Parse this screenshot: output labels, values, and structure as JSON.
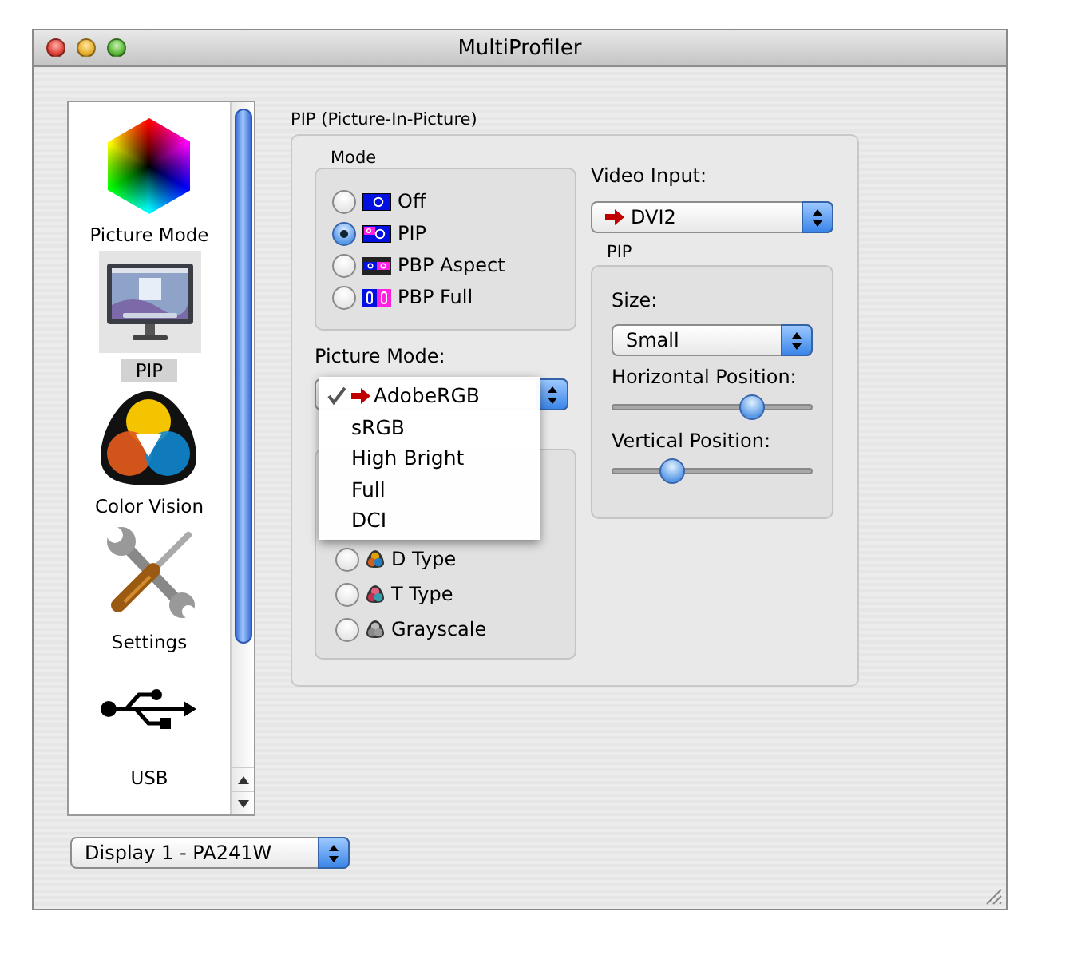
{
  "window": {
    "title": "MultiProfiler"
  },
  "sidebar": {
    "items": [
      {
        "label": "Picture Mode",
        "kind": "hexagon",
        "selected": false
      },
      {
        "label": "PIP",
        "kind": "monitor",
        "selected": true
      },
      {
        "label": "Color Vision",
        "kind": "colorvision",
        "selected": false
      },
      {
        "label": "Settings",
        "kind": "tools",
        "selected": false
      },
      {
        "label": "USB",
        "kind": "usb",
        "selected": false
      }
    ]
  },
  "pip_panel": {
    "title": "PIP (Picture-In-Picture)",
    "mode": {
      "title": "Mode",
      "options": [
        {
          "label": "Off",
          "kind": "off",
          "selected": false
        },
        {
          "label": "PIP",
          "kind": "pip",
          "selected": true
        },
        {
          "label": "PBP Aspect",
          "kind": "pbp-aspect",
          "selected": false
        },
        {
          "label": "PBP Full",
          "kind": "pbp-full",
          "selected": false
        }
      ]
    },
    "picture_mode": {
      "label": "Picture Mode:",
      "menu": [
        {
          "label": "AdobeRGB",
          "checked": true,
          "current": true
        },
        {
          "label": "sRGB",
          "checked": false,
          "current": false
        },
        {
          "label": "High Bright",
          "checked": false,
          "current": false
        },
        {
          "label": "Full",
          "checked": false,
          "current": false
        },
        {
          "label": "DCI",
          "checked": false,
          "current": false
        }
      ]
    },
    "color_vision": {
      "options": [
        {
          "label": "D Type",
          "kind": "d",
          "selected": false
        },
        {
          "label": "T Type",
          "kind": "t",
          "selected": false
        },
        {
          "label": "Grayscale",
          "kind": "gray",
          "selected": false
        }
      ]
    },
    "video_input": {
      "label": "Video Input:",
      "value": "DVI2",
      "current": true
    },
    "pip": {
      "title": "PIP",
      "size": {
        "label": "Size:",
        "value": "Small"
      },
      "sliders": [
        {
          "label": "Horizontal Position:",
          "level": 0.7
        },
        {
          "label": "Vertical Position:",
          "level": 0.3
        }
      ]
    }
  },
  "display": {
    "value": "Display 1 - PA241W"
  }
}
